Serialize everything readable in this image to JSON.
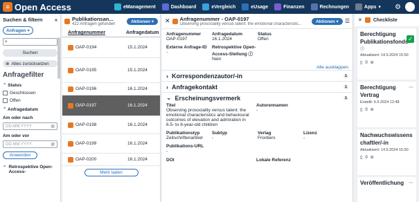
{
  "app": {
    "title": "Open Access"
  },
  "nav": [
    {
      "label": "eManagement",
      "color": "#2fb4cf"
    },
    {
      "label": "Dashboard",
      "color": "#5b6cd6"
    },
    {
      "label": "eVergleich",
      "color": "#3aa0de"
    },
    {
      "label": "eUsage",
      "color": "#2c6fb4"
    },
    {
      "label": "Finanzen",
      "color": "#7c5bd1"
    },
    {
      "label": "Rechnungen",
      "color": "#5a6fb0"
    },
    {
      "label": "Apps",
      "color": "#6f7b88"
    }
  ],
  "sidebar": {
    "title": "Suchen & filtern",
    "select": "Anfragen",
    "search_btn": "Suchen",
    "reset": "Alles zurücksetzen",
    "filter_title": "Anfragefilter",
    "status_label": "Status",
    "opt1": "Geschlossen",
    "opt2": "Offen",
    "date_label": "Anfragedatum",
    "after_label": "Am oder nach",
    "before_label": "Am oder vor",
    "date_placeholder": "DD.MM.YYYY",
    "apply": "Anwenden",
    "retro": "Retrospektive Open-Access-"
  },
  "list": {
    "title": "Publikationsan...",
    "count": "422 Anfragen gefunden",
    "action": "Aktionen",
    "col1": "Anfragenummer",
    "col2": "Anfragedatum",
    "rows": [
      {
        "id": "OAP-0194",
        "date": "15.1.2024"
      },
      {
        "id": "OAP-0195",
        "date": "15.1.2024"
      },
      {
        "id": "OAP-0196",
        "date": "16.1.2024"
      },
      {
        "id": "OAP-0197",
        "date": "16.1.2024"
      },
      {
        "id": "OAP-0198",
        "date": "16.1.2024"
      },
      {
        "id": "OAP-0199",
        "date": "16.1.2024"
      },
      {
        "id": "OAP-0200",
        "date": "16.1.2024"
      }
    ],
    "more": "Mehr laden"
  },
  "detail": {
    "title": "Anfragenummer - OAP-0197",
    "subtitle": "Observing prosociality versus talent: the emotional characteristic...",
    "action": "Aktionen",
    "f1k": "Anfragenummer",
    "f1v": "OAP-0197",
    "f2k": "Anfragedatum",
    "f2v": "16.1.2024",
    "f3k": "Status",
    "f3v": "Offen",
    "f4k": "Externe Anfrage-ID",
    "f4v": "-",
    "f5k": "Retrospektive Open-Access-Stellung",
    "f5v": "Nein",
    "collapse": "Alle ausklappen",
    "sec1": "Korrespondenzautor/-in",
    "sec1c": "1",
    "sec2": "Anfragekontakt",
    "sec2c": "1",
    "sec3": "Erscheinungsvermerk",
    "sec3c": "1",
    "titel_k": "Titel",
    "titel_v": "Observing prosociality versus talent: the emotional characteristics and behavioural outcomes of elevation and admiration in 6.5- to 8-year-old children",
    "autoren_k": "Autorennamen",
    "autoren_v": "-",
    "pt_k": "Publikationstyp",
    "pt_v": "Zeitschriftenartikel",
    "st_k": "Subtyp",
    "st_v": "-",
    "vl_k": "Verlag",
    "vl_v": "Frontiers",
    "li_k": "Lizenz",
    "li_v": "-",
    "url_k": "Publikations-URL",
    "url_v": "-",
    "doi_k": "DOI",
    "lr_k": "Lokale Referenz"
  },
  "checklist": {
    "title": "Checkliste",
    "cards": [
      {
        "title": "Berechtigung Publikationsfonds",
        "meta": "Aktualisiert: 14.5.2024 15:50",
        "count": "0"
      },
      {
        "title": "Berechtigung Vertrag",
        "meta": "Erstellt: 6.5.2024 12:48",
        "count": "0"
      },
      {
        "title": "Nachwuchswissenschaftler/-in",
        "meta": "Aktualisiert: 14.5.2024 15:50",
        "count": "0"
      },
      {
        "title": "Veröffentlichung",
        "meta": "",
        "count": ""
      }
    ]
  }
}
